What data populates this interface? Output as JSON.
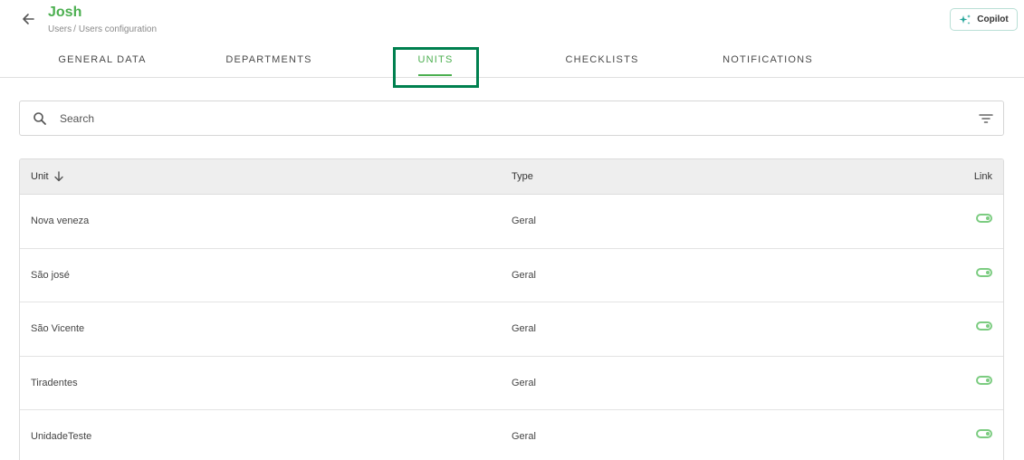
{
  "header": {
    "title": "Josh",
    "breadcrumb": [
      "Users",
      "Users configuration"
    ],
    "breadcrumb_separator": "/",
    "copilot_label": "Copilot"
  },
  "tabs": [
    {
      "label": "GENERAL DATA",
      "active": false
    },
    {
      "label": "DEPARTMENTS",
      "active": false
    },
    {
      "label": "UNITS",
      "active": true
    },
    {
      "label": "CHECKLISTS",
      "active": false
    },
    {
      "label": "NOTIFICATIONS",
      "active": false
    }
  ],
  "search": {
    "placeholder": "Search",
    "value": ""
  },
  "table": {
    "columns": {
      "unit": "Unit",
      "type": "Type",
      "link": "Link"
    },
    "sort": {
      "column": "unit",
      "direction": "descending"
    },
    "rows": [
      {
        "unit": "Nova veneza",
        "type": "Geral",
        "linked": true
      },
      {
        "unit": "São josé",
        "type": "Geral",
        "linked": true
      },
      {
        "unit": "São Vicente",
        "type": "Geral",
        "linked": true
      },
      {
        "unit": "Tiradentes",
        "type": "Geral",
        "linked": true
      },
      {
        "unit": "UnidadeTeste",
        "type": "Geral",
        "linked": true
      }
    ]
  },
  "colors": {
    "accent": "#4caf50",
    "highlight_border": "#00804f",
    "toggle_on": "#7ccc81"
  },
  "icons": {
    "back": "arrow-left-icon",
    "copilot": "sparkle-icon",
    "search": "search-icon",
    "filter": "filter-icon",
    "sort": "arrow-down-icon",
    "link_toggle": "toggle-icon"
  }
}
